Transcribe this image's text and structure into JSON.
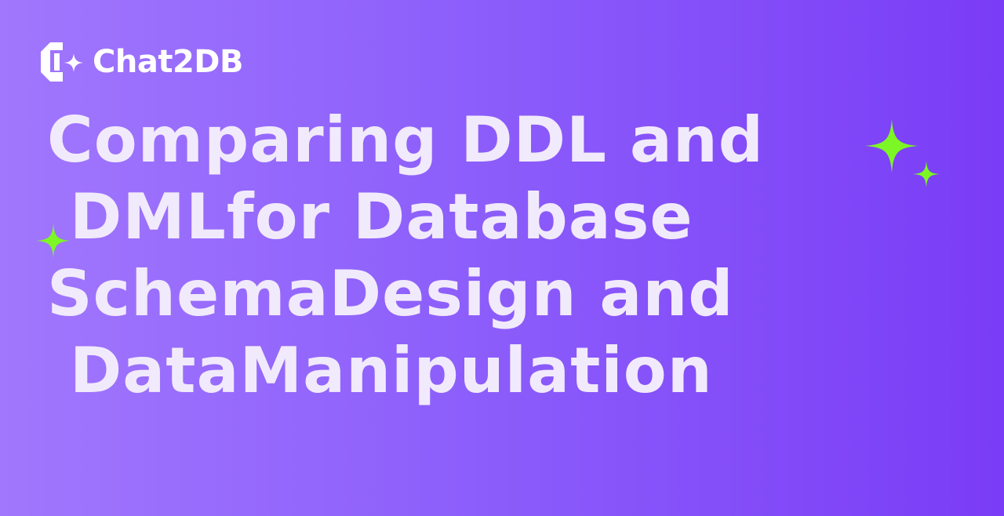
{
  "brand": {
    "name": "Chat2DB",
    "logo_icon": "chat2db-logo-icon"
  },
  "headline": {
    "lines": [
      "Comparing DDL and",
      " DMLfor Database",
      "SchemaDesign and",
      " DataManipulation"
    ]
  },
  "decorations": {
    "sparkle_icon": "sparkle-icon",
    "sparkle_color": "#7cf625"
  },
  "colors": {
    "background_start": "#a177fd",
    "background_end": "#7a3cf6",
    "headline_text": "#f1eafc",
    "logo_text": "#ffffff"
  }
}
